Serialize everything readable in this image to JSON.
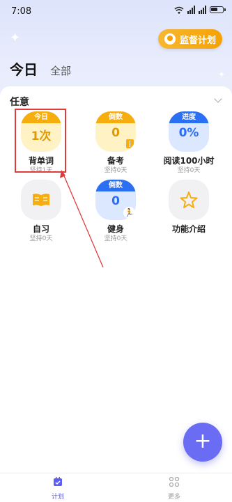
{
  "status_bar": {
    "time": "7:08",
    "battery_icon": "battery-icon",
    "wifi_icon": "wifi-icon"
  },
  "header": {
    "supervise_label": "监督计划",
    "tabs": [
      {
        "label": "今日",
        "active": true
      },
      {
        "label": "全部",
        "active": false
      }
    ]
  },
  "section": {
    "title": "任意"
  },
  "habits": [
    {
      "name": "背单词",
      "sub": "坚持1天",
      "caption": "今日",
      "value": "1次",
      "style": "yellow"
    },
    {
      "name": "备考",
      "sub": "坚持0天",
      "caption": "倒数",
      "value": "0",
      "style": "yellow"
    },
    {
      "name": "阅读100小时",
      "sub": "坚持0天",
      "caption": "进度",
      "value": "0%",
      "style": "blue"
    },
    {
      "name": "自习",
      "sub": "坚持0天",
      "caption": "",
      "value": "",
      "style": "grey"
    },
    {
      "name": "健身",
      "sub": "坚持0天",
      "caption": "倒数",
      "value": "0",
      "style": "blue"
    },
    {
      "name": "功能介绍",
      "sub": "",
      "caption": "",
      "value": "",
      "style": "grey"
    }
  ],
  "fab": {
    "label": "+"
  },
  "bottom_nav": [
    {
      "label": "计划",
      "active": true
    },
    {
      "label": "更多",
      "active": false
    }
  ],
  "colors": {
    "accent": "#5b5ef0",
    "yellow": "#f6ad10",
    "blue": "#2b6ff3",
    "fab": "#6a6cf3",
    "annotation": "#e03b3b"
  }
}
